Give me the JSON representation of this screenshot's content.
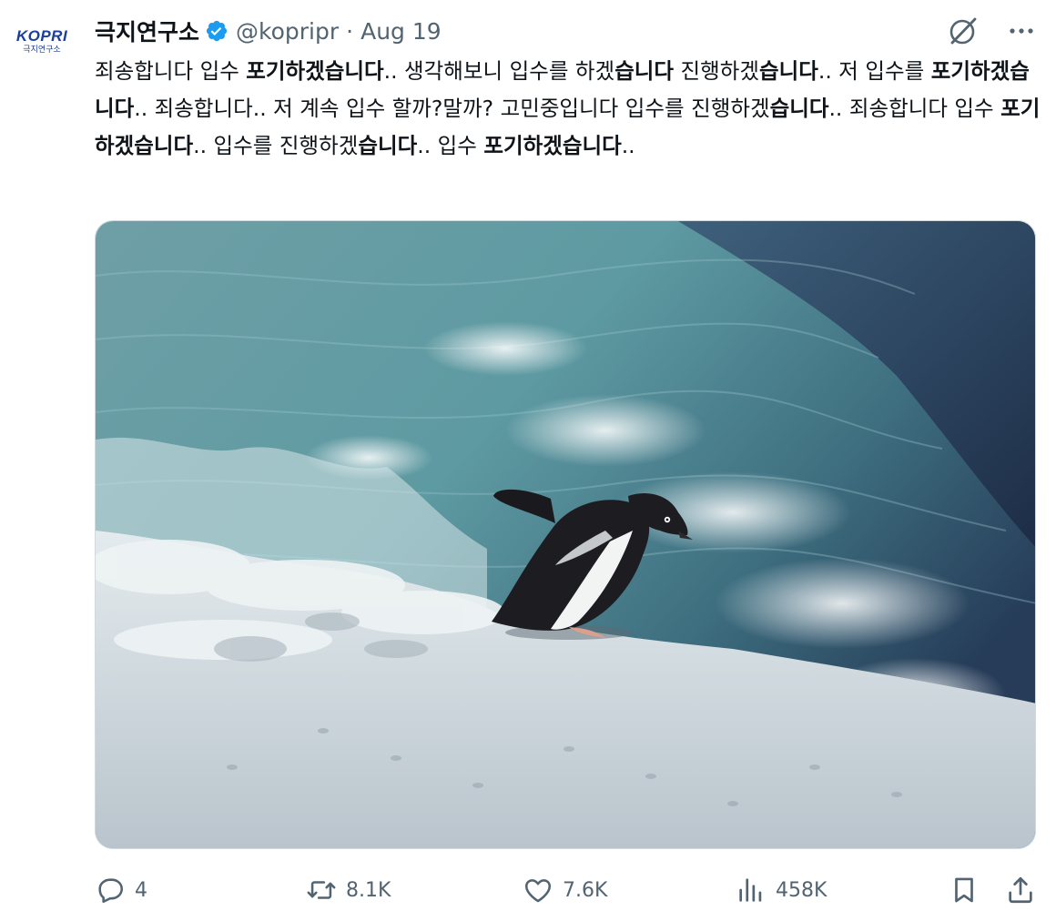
{
  "author": {
    "display_name": "극지연구소",
    "handle": "@kopripr",
    "separator": "·",
    "date": "Aug 19",
    "avatar_logo": "KOPRI",
    "avatar_sub": "극지연구소",
    "verified_color": "#1d9bf0"
  },
  "tweet": {
    "segments": [
      {
        "text": "죄송합니다 입수 ",
        "bold": false
      },
      {
        "text": "포기하겠습니다",
        "bold": true
      },
      {
        "text": ".. 생각해보니 입수를 하겠",
        "bold": false
      },
      {
        "text": "습니다",
        "bold": true
      },
      {
        "text": " 진행하겠",
        "bold": false
      },
      {
        "text": "습니다",
        "bold": true
      },
      {
        "text": ".. 저 입수를 ",
        "bold": false
      },
      {
        "text": "포기하겠습니다",
        "bold": true
      },
      {
        "text": ".. 죄송합니다.. 저 계속 입수 할까?말까? 고민중입니다 입수를 진행하겠",
        "bold": false
      },
      {
        "text": "습니다",
        "bold": true
      },
      {
        "text": ".. 죄송합니다 입수 ",
        "bold": false
      },
      {
        "text": "포기하겠습니다",
        "bold": true
      },
      {
        "text": ".. 입수를 진행하겠",
        "bold": false
      },
      {
        "text": "습니다",
        "bold": true
      },
      {
        "text": ".. 입수 ",
        "bold": false
      },
      {
        "text": "포기하겠습니다",
        "bold": true
      },
      {
        "text": "..",
        "bold": false
      }
    ]
  },
  "media": {
    "type": "photo",
    "subject": "penguin-on-ice-edge"
  },
  "actions": {
    "reply": {
      "icon": "reply-icon",
      "count": "4"
    },
    "retweet": {
      "icon": "retweet-icon",
      "count": "8.1K"
    },
    "like": {
      "icon": "heart-icon",
      "count": "7.6K"
    },
    "views": {
      "icon": "views-icon",
      "count": "458K"
    },
    "bookmark": {
      "icon": "bookmark-icon"
    },
    "share": {
      "icon": "share-icon"
    }
  },
  "colors": {
    "text_primary": "#0f1419",
    "text_secondary": "#536471",
    "accent": "#1d9bf0",
    "kopri_blue": "#1c3f9c"
  }
}
